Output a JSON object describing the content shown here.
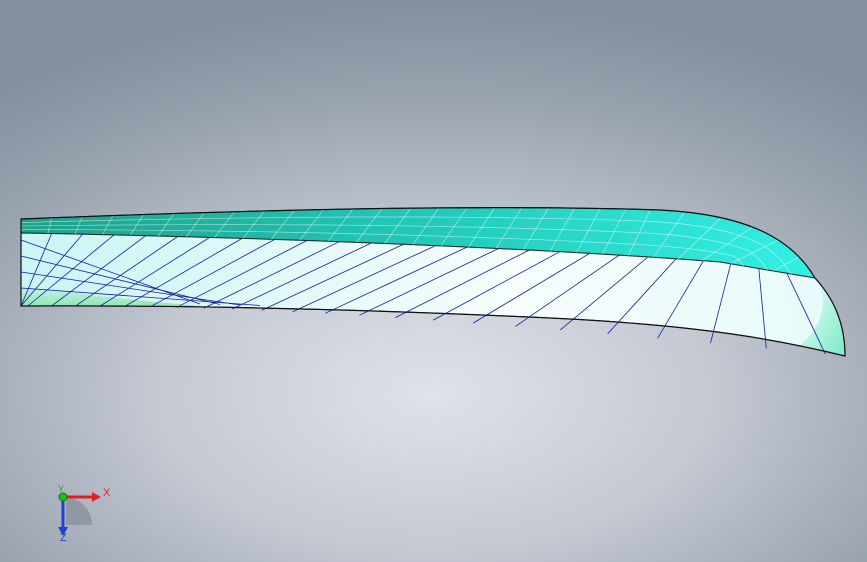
{
  "viewport": {
    "model": "swept-blade-surface",
    "colors": {
      "background_center": "#dfe2e8",
      "background_edge": "#848e9c",
      "top_face": "#29e0d2",
      "side_face": "#f2fbfc",
      "edge_mesh": "#1a1aa0",
      "outline": "#222222"
    }
  },
  "triad": {
    "x_label": "X",
    "y_label": "Y",
    "z_label": "Z",
    "colors": {
      "x": "#e02020",
      "y": "#20c020",
      "z": "#2040d0"
    }
  }
}
